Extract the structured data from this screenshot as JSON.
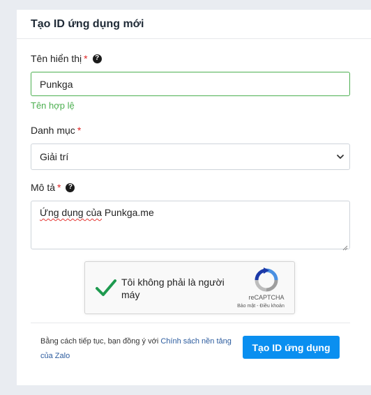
{
  "form": {
    "title": "Tạo ID ứng dụng mới",
    "name_field": {
      "label": "Tên hiển thị",
      "required_mark": "*",
      "help_icon": "?",
      "value": "Punkga",
      "validation_message": "Tên hợp lệ"
    },
    "category_field": {
      "label": "Danh mục",
      "required_mark": "*",
      "selected": "Giải trí"
    },
    "description_field": {
      "label": "Mô tả",
      "required_mark": "*",
      "help_icon": "?",
      "value_misspelled": "Ứng dụng của",
      "value_rest": " Punkga.me"
    },
    "captcha": {
      "label": "Tôi không phải là người máy",
      "brand": "reCAPTCHA",
      "terms": "Bảo mật - Điều khoản"
    },
    "footer": {
      "note_prefix": "Bằng cách tiếp tục, bạn đồng ý với ",
      "policy_link": "Chính sách nền tảng của Zalo",
      "submit_label": "Tạo ID ứng dụng"
    }
  },
  "colors": {
    "accent": "#0a8ff0",
    "valid": "#4caf50",
    "required": "#e02424",
    "link": "#2b5b9e"
  },
  "icons": {
    "help": "question-circle-icon",
    "select": "chevron-down-icon",
    "captcha_check": "check-icon",
    "captcha_logo": "recaptcha-logo-icon"
  }
}
